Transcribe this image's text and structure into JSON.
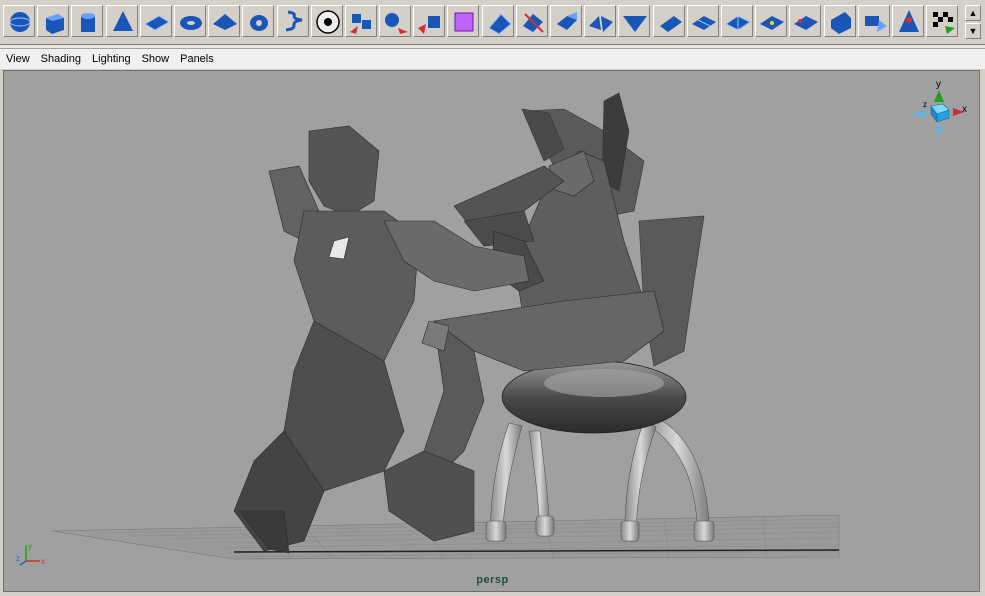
{
  "shelf": {
    "tools": [
      {
        "name": "polygon-sphere-icon"
      },
      {
        "name": "polygon-cube-icon"
      },
      {
        "name": "polygon-cylinder-icon"
      },
      {
        "name": "polygon-cone-icon"
      },
      {
        "name": "polygon-plane-icon"
      },
      {
        "name": "polygon-torus-icon"
      },
      {
        "name": "polygon-pyramid-icon"
      },
      {
        "name": "polygon-pipe-icon"
      },
      {
        "name": "polygon-helix-icon"
      },
      {
        "name": "soccer-ball-icon"
      },
      {
        "name": "combine-icon"
      },
      {
        "name": "separate-icon"
      },
      {
        "name": "extract-icon"
      },
      {
        "name": "smooth-proxy-icon"
      },
      {
        "name": "split-polygon-icon"
      },
      {
        "name": "cut-faces-icon"
      },
      {
        "name": "extrude-face-icon"
      },
      {
        "name": "bridge-icon"
      },
      {
        "name": "wedge-faces-icon"
      },
      {
        "name": "poke-faces-icon"
      },
      {
        "name": "extrude-edge-icon"
      },
      {
        "name": "subdivide-icon"
      },
      {
        "name": "merge-vertices-icon"
      },
      {
        "name": "duplicate-face-icon"
      },
      {
        "name": "bevel-icon"
      },
      {
        "name": "append-polygon-icon"
      },
      {
        "name": "sculpt-geometry-icon"
      },
      {
        "name": "uv-texture-editor-icon"
      }
    ],
    "scroll_up": "▲",
    "scroll_down": "▼"
  },
  "menu": {
    "view": "View",
    "shading": "Shading",
    "lighting": "Lighting",
    "show": "Show",
    "panels": "Panels"
  },
  "viewport": {
    "camera_label": "persp",
    "background_color": "#a0a0a0",
    "view_cube": {
      "y": "y",
      "x": "x",
      "z": "z"
    },
    "axis_gizmo": {
      "x": "x",
      "y": "y",
      "z": "z"
    }
  },
  "colors": {
    "icon_blue": "#1a55b8",
    "axis_x": "#d03030",
    "axis_y": "#20a020",
    "axis_z": "#2060d0"
  }
}
